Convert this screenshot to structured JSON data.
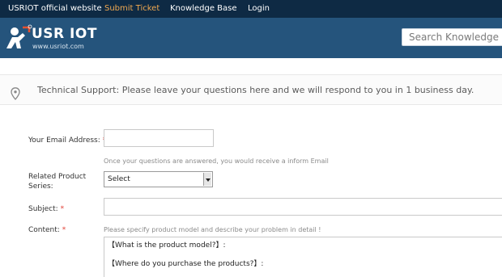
{
  "topnav": {
    "items": [
      {
        "label": "USRIOT official website"
      },
      {
        "label": "Submit Ticket"
      },
      {
        "label": "Knowledge Base"
      },
      {
        "label": "Login"
      }
    ],
    "active_color": "#f0a850"
  },
  "banner": {
    "brand": "USR IOT",
    "url": "www.usriot.com",
    "search_placeholder": "Search Knowledge Base",
    "background": "#25547c"
  },
  "notice": {
    "icon": "location-pin-icon",
    "text": "Technical Support: Please leave your questions here and we will respond to you in 1 business day."
  },
  "form": {
    "email": {
      "label": "Your Email Address:",
      "required": "*",
      "value": "",
      "hint": "Once your questions are answered, you would receive a inform Email"
    },
    "series": {
      "label_line1": "Related Product",
      "label_line2": "Series:",
      "selected": "Select"
    },
    "subject": {
      "label": "Subject:",
      "required": "*",
      "value": ""
    },
    "content": {
      "label": "Content:",
      "required": "*",
      "hint": "Please specify product model and describe your problem in detail !",
      "line1": "【What is the product model?】:",
      "line2": "【Where do you purchase the products?】:"
    }
  }
}
